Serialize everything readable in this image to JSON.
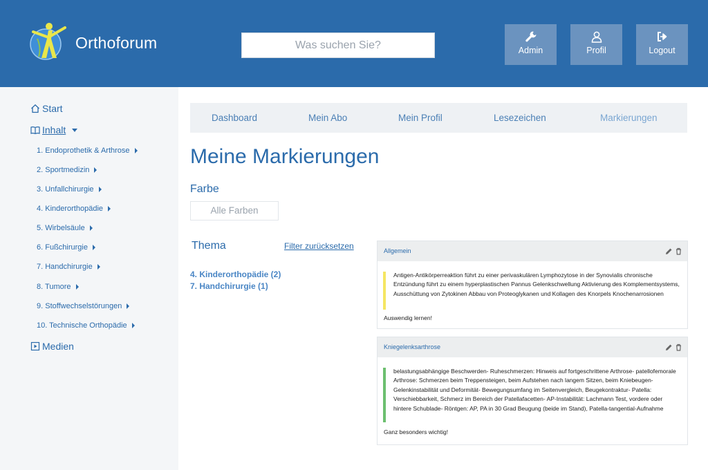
{
  "header": {
    "brand": "Orthoforum",
    "search_placeholder": "Was suchen Sie?",
    "buttons": [
      {
        "label": "Admin",
        "icon": "wrench-icon"
      },
      {
        "label": "Profil",
        "icon": "user-icon"
      },
      {
        "label": "Logout",
        "icon": "logout-icon"
      }
    ]
  },
  "sidebar": {
    "start": "Start",
    "inhalt": "Inhalt",
    "items": [
      "1. Endoprothetik & Arthrose",
      "2. Sportmedizin",
      "3. Unfallchirurgie",
      "4. Kinderorthopädie",
      "5. Wirbelsäule",
      "6. Fußchirurgie",
      "7. Handchirurgie",
      "8. Tumore",
      "9. Stoffwechselstörungen",
      "10. Technische Orthopädie"
    ],
    "medien": "Medien"
  },
  "tabs": [
    "Dashboard",
    "Mein Abo",
    "Mein Profil",
    "Lesezeichen",
    "Markierungen"
  ],
  "main": {
    "title": "Meine Markierungen",
    "farbe_label": "Farbe",
    "farbe_select": "Alle Farben",
    "thema_label": "Thema",
    "filter_reset": "Filter zurücksetzen",
    "themes": [
      "4. Kinderorthopädie (2)",
      "7. Handchirurgie (1)"
    ]
  },
  "cards": [
    {
      "category": "Allgemein",
      "highlight_color": "#f5e663",
      "text": "Antigen-Antikörperreaktion führt zu einer perivaskulären Lymphozytose in der Synovialis chronische Entzündung führt zu einem hyperplastischen Pannus Gelenkschwellung Aktivierung des Komplementsystems, Ausschüttung von Zytokinen Abbau von Proteoglykanen und Kollagen des Knorpels Knochenarrosionen",
      "note": "Auswendig lernen!"
    },
    {
      "category": "Kniegelenksarthrose",
      "highlight_color": "#6cbf6f",
      "text": "belastungsabhängige Beschwerden- Ruheschmerzen: Hinweis auf fortgeschrittene Arthrose- patellofemorale Arthrose: Schmerzen beim Treppensteigen, beim Aufstehen nach langem  Sitzen, beim Kniebeugen- Gelenkinstabilität und Deformität- Bewegungsumfang im Seitenvergleich, Beugekontraktur- Patella: Verschiebbarkeit, Schmerz im Bereich der Patellafacetten- AP-Instabilität: Lachmann Test, vordere oder hintere Schublade- Röntgen: AP, PA in 30 Grad Beugung (beide im Stand), Patella-tangential-Aufnahme",
      "note": "Ganz besonders wichtig!"
    }
  ]
}
